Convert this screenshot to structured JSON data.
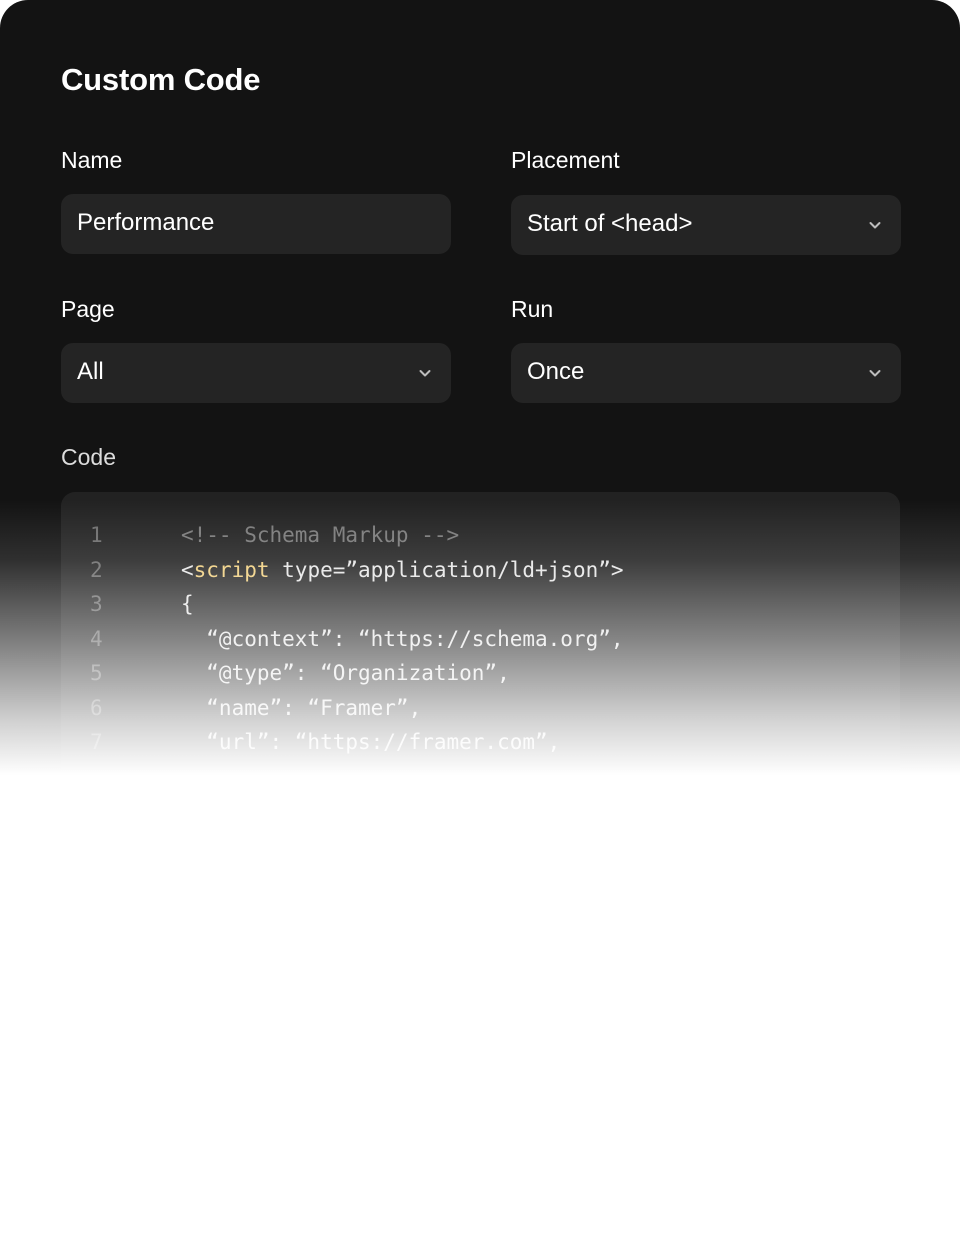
{
  "panel": {
    "title": "Custom Code"
  },
  "fields": {
    "name": {
      "label": "Name",
      "value": "Performance"
    },
    "placement": {
      "label": "Placement",
      "selected": "Start of <head>",
      "icon": "chevron-down-icon"
    },
    "page": {
      "label": "Page",
      "selected": "All",
      "icon": "chevron-down-icon"
    },
    "run": {
      "label": "Run",
      "selected": "Once",
      "icon": "chevron-down-icon"
    }
  },
  "code": {
    "label": "Code",
    "lines": [
      {
        "num": "1",
        "parts": [
          {
            "t": "<!-- Schema Markup -->",
            "c": "cm"
          }
        ]
      },
      {
        "num": "2",
        "parts": [
          {
            "t": "<",
            "c": ""
          },
          {
            "t": "script",
            "c": "kw"
          },
          {
            "t": " type=”application/ld+json”>",
            "c": ""
          }
        ]
      },
      {
        "num": "3",
        "parts": [
          {
            "t": "{",
            "c": ""
          }
        ]
      },
      {
        "num": "4",
        "parts": [
          {
            "t": "  “@context”: “https://schema.org”,",
            "c": ""
          }
        ]
      },
      {
        "num": "5",
        "parts": [
          {
            "t": "  “@type”: “Organization”,",
            "c": ""
          }
        ]
      },
      {
        "num": "6",
        "parts": [
          {
            "t": "  “name”: “Framer”,",
            "c": ""
          }
        ]
      },
      {
        "num": "7",
        "parts": [
          {
            "t": "  “url”: “https://framer.com”,",
            "c": ""
          }
        ]
      }
    ]
  },
  "colors": {
    "panel_bg": "#131313",
    "field_bg": "#242424",
    "code_bg": "#222222",
    "keyword": "#f0cf7e",
    "comment": "#7a7a7a",
    "line_number": "#6d6d6d"
  }
}
